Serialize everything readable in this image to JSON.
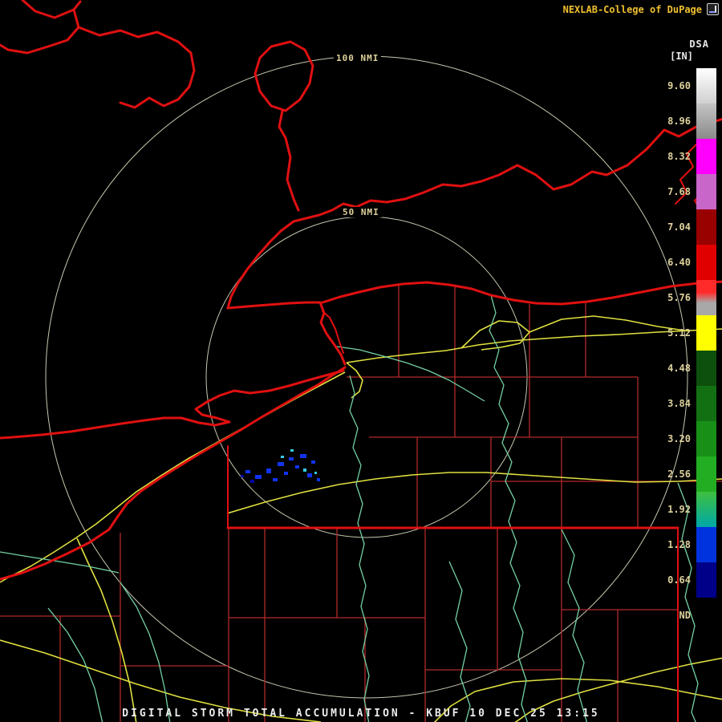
{
  "header": {
    "attribution": "NEXLAB-College of DuPage",
    "logo_icon": "cod-logo"
  },
  "product": {
    "name": "DSA",
    "units": "[IN]"
  },
  "range_rings": {
    "outer_label": "100 NMI",
    "inner_label": "50 NMI"
  },
  "colorbar": {
    "items": [
      {
        "value": "9.60",
        "color": "linear-gradient(180deg,#ffffff,#d0d0d0)"
      },
      {
        "value": "8.96",
        "color": "linear-gradient(180deg,#c4c4c4,#8a8a8a)"
      },
      {
        "value": "8.32",
        "color": "#ff00ff"
      },
      {
        "value": "7.68",
        "color": "#c966c9"
      },
      {
        "value": "7.04",
        "color": "#990000"
      },
      {
        "value": "6.40",
        "color": "#e00000"
      },
      {
        "value": "5.76",
        "color": "linear-gradient(180deg,#ff2a2a 0%,#ff2a2a 35%,#a8a8a8 65%,#a8a8a8 100%)"
      },
      {
        "value": "5.12",
        "color": "#ffff00"
      },
      {
        "value": "4.48",
        "color": "#0d4f0d"
      },
      {
        "value": "3.84",
        "color": "#127012"
      },
      {
        "value": "3.20",
        "color": "#189018"
      },
      {
        "value": "2.56",
        "color": "#23ad23"
      },
      {
        "value": "1.92",
        "color": "linear-gradient(180deg,#3fbf3f,#00a8a8)"
      },
      {
        "value": "1.28",
        "color": "#0033dd"
      },
      {
        "value": "0.64",
        "color": "#000088"
      },
      {
        "value": "ND",
        "color": "#000000"
      }
    ]
  },
  "caption": "DIGITAL STORM TOTAL ACCUMULATION - KBUF 10 DEC 25 13:15",
  "colors": {
    "shoreline": "#e01010",
    "county": "#b22a2a",
    "highway": "#e0e040",
    "river": "#74d1a4",
    "ring": "#c8c8b0",
    "echo_blue": "#1133ee",
    "echo_cyan": "#33cce0",
    "echo_dark": "#0000a0",
    "attribution": "#f0c030",
    "labels": "#ddd19c",
    "product": "#e8e8e8",
    "caption": "#ececec"
  }
}
